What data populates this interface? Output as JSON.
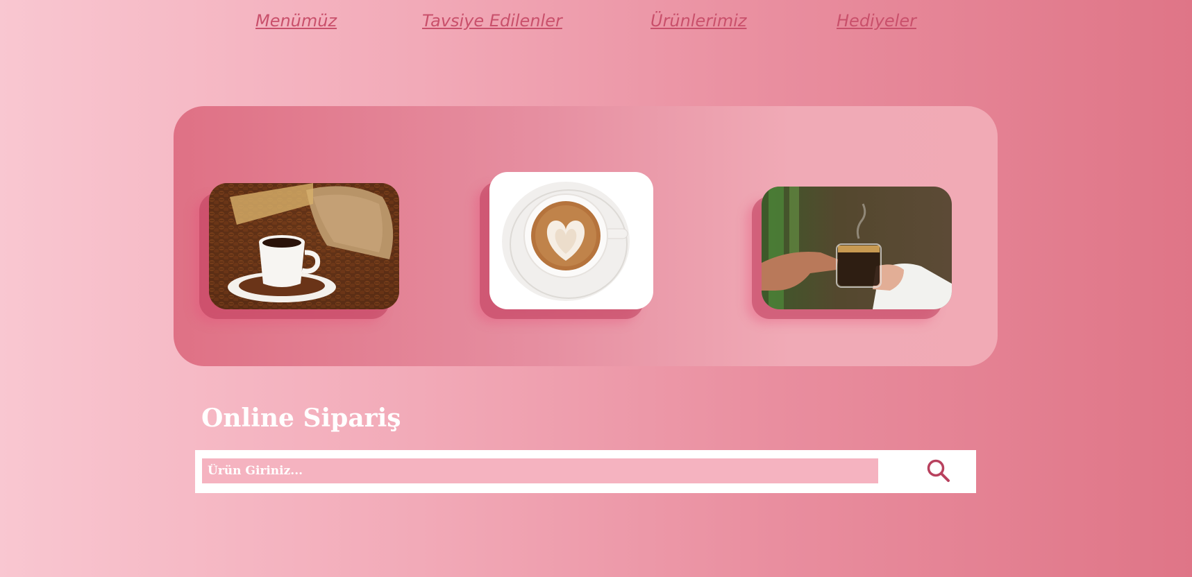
{
  "nav": {
    "items": [
      {
        "label": "Menümüz"
      },
      {
        "label": "Tavsiye Edilenler"
      },
      {
        "label": "Ürünlerimiz"
      },
      {
        "label": "Hediyeler"
      }
    ]
  },
  "gallery": {
    "images": [
      {
        "subject": "coffee cup with coffee beans and burlap sack"
      },
      {
        "subject": "latte art heart cup top view"
      },
      {
        "subject": "hands holding espresso glass"
      }
    ]
  },
  "order": {
    "title": "Online Sipariş",
    "search_placeholder": "Ürün Giriniz...",
    "search_value": "",
    "search_icon": "search-icon"
  },
  "colors": {
    "accent": "#c9506b",
    "icon": "#b8415e",
    "input_bg": "#f5b3c0"
  }
}
